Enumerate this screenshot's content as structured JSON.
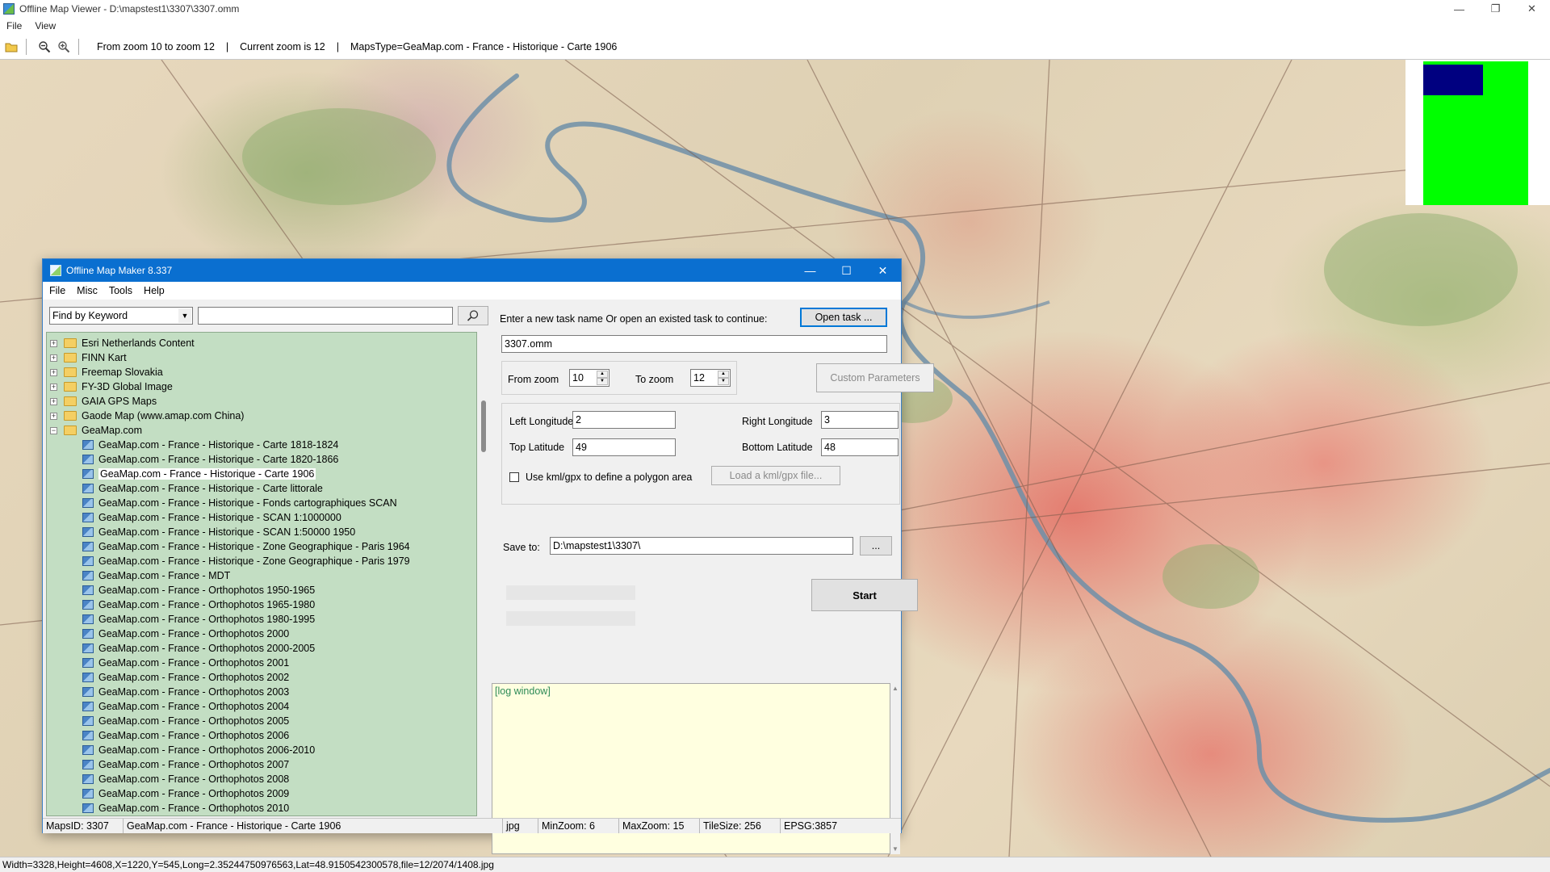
{
  "window": {
    "title": "Offline Map Viewer - D:\\mapstest1\\3307\\3307.omm",
    "controls": [
      "—",
      "❐",
      "✕"
    ]
  },
  "menu": [
    "File",
    "View"
  ],
  "toolbar": {
    "zoom_range": "From zoom 10 to zoom 12",
    "current_zoom": "Current zoom is 12",
    "maps_type": "MapsType=GeaMap.com - France - Historique - Carte 1906",
    "sep": "|",
    "icons": [
      "open-folder-icon",
      "zoom-out-icon",
      "zoom-in-icon"
    ]
  },
  "statusbar": "Width=3328,Height=4608,X=1220,Y=545,Long=2.35244750976563,Lat=48.9150542300578,file=12/2074/1408.jpg",
  "overview_colors": {
    "background": "#00ff00",
    "viewport": "#000080"
  },
  "dialog": {
    "title": "Offline Map Maker 8.337",
    "controls": [
      "—",
      "☐",
      "✕"
    ],
    "menu": [
      "File",
      "Misc",
      "Tools",
      "Help"
    ],
    "find_mode": "Find by Keyword",
    "find_value": "",
    "tree": [
      {
        "label": "Esri Netherlands Content",
        "level": 0,
        "expander": "+"
      },
      {
        "label": "FINN Kart",
        "level": 0,
        "expander": "+"
      },
      {
        "label": "Freemap Slovakia",
        "level": 0,
        "expander": "+"
      },
      {
        "label": "FY-3D Global Image",
        "level": 0,
        "expander": "+"
      },
      {
        "label": "GAIA GPS Maps",
        "level": 0,
        "expander": "+"
      },
      {
        "label": "Gaode Map (www.amap.com China)",
        "level": 0,
        "expander": "+"
      },
      {
        "label": "GeaMap.com",
        "level": 0,
        "expander": "−"
      },
      {
        "label": "GeaMap.com - France - Historique - Carte 1818-1824",
        "level": 1
      },
      {
        "label": "GeaMap.com - France - Historique - Carte 1820-1866",
        "level": 1
      },
      {
        "label": "GeaMap.com - France - Historique - Carte 1906",
        "level": 1,
        "selected": true
      },
      {
        "label": "GeaMap.com - France - Historique - Carte littorale",
        "level": 1
      },
      {
        "label": "GeaMap.com - France - Historique - Fonds cartographiques SCAN",
        "level": 1
      },
      {
        "label": "GeaMap.com - France - Historique - SCAN 1:1000000",
        "level": 1
      },
      {
        "label": "GeaMap.com - France - Historique - SCAN 1:50000 1950",
        "level": 1
      },
      {
        "label": "GeaMap.com - France - Historique - Zone Geographique - Paris 1964",
        "level": 1
      },
      {
        "label": "GeaMap.com - France - Historique - Zone Geographique - Paris 1979",
        "level": 1
      },
      {
        "label": "GeaMap.com - France - MDT",
        "level": 1
      },
      {
        "label": "GeaMap.com - France - Orthophotos 1950-1965",
        "level": 1
      },
      {
        "label": "GeaMap.com - France - Orthophotos 1965-1980",
        "level": 1
      },
      {
        "label": "GeaMap.com - France - Orthophotos 1980-1995",
        "level": 1
      },
      {
        "label": "GeaMap.com - France - Orthophotos 2000",
        "level": 1
      },
      {
        "label": "GeaMap.com - France - Orthophotos 2000-2005",
        "level": 1
      },
      {
        "label": "GeaMap.com - France - Orthophotos 2001",
        "level": 1
      },
      {
        "label": "GeaMap.com - France - Orthophotos 2002",
        "level": 1
      },
      {
        "label": "GeaMap.com - France - Orthophotos 2003",
        "level": 1
      },
      {
        "label": "GeaMap.com - France - Orthophotos 2004",
        "level": 1
      },
      {
        "label": "GeaMap.com - France - Orthophotos 2005",
        "level": 1
      },
      {
        "label": "GeaMap.com - France - Orthophotos 2006",
        "level": 1
      },
      {
        "label": "GeaMap.com - France - Orthophotos 2006-2010",
        "level": 1
      },
      {
        "label": "GeaMap.com - France - Orthophotos 2007",
        "level": 1
      },
      {
        "label": "GeaMap.com - France - Orthophotos 2008",
        "level": 1
      },
      {
        "label": "GeaMap.com - France - Orthophotos 2009",
        "level": 1
      },
      {
        "label": "GeaMap.com - France - Orthophotos 2010",
        "level": 1
      }
    ],
    "task_prompt": "Enter a new task name Or open an existed task to continue:",
    "open_task_button": "Open task ...",
    "task_name": "3307.omm",
    "from_zoom_label": "From zoom",
    "from_zoom": "10",
    "to_zoom_label": "To zoom",
    "to_zoom": "12",
    "custom_params_button": "Custom Parameters",
    "left_lon_label": "Left Longitude",
    "left_lon": "2",
    "right_lon_label": "Right Longitude",
    "right_lon": "3",
    "top_lat_label": "Top Latitude",
    "top_lat": "49",
    "bottom_lat_label": "Bottom Latitude",
    "bottom_lat": "48",
    "kml_checkbox_label": "Use kml/gpx to define a polygon area",
    "load_kml_button": "Load a kml/gpx file...",
    "save_to_label": "Save to:",
    "save_to": "D:\\mapstest1\\3307\\",
    "browse_button": "...",
    "start_button": "Start",
    "log": "[log window]",
    "status": {
      "maps_id": "MapsID: 3307",
      "maps_name": "GeaMap.com - France - Historique - Carte 1906",
      "format": "jpg",
      "min_zoom": "MinZoom: 6",
      "max_zoom": "MaxZoom: 15",
      "tile_size": "TileSize: 256",
      "epsg": "EPSG:3857"
    }
  }
}
